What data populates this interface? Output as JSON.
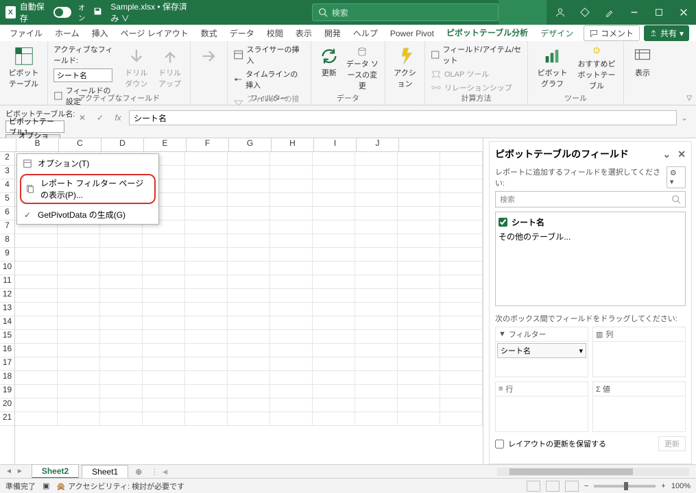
{
  "titlebar": {
    "autosave_label": "自動保存",
    "autosave_state": "オン",
    "filename": "Sample.xlsx • 保存済み ∨",
    "search_placeholder": "検索"
  },
  "tabs": {
    "items": [
      "ファイル",
      "ホーム",
      "挿入",
      "ページ レイアウト",
      "数式",
      "データ",
      "校閲",
      "表示",
      "開発",
      "ヘルプ",
      "Power Pivot",
      "ピボットテーブル分析",
      "デザイン"
    ],
    "active_index": 11,
    "comment_label": "コメント",
    "share_label": "共有"
  },
  "ribbon": {
    "pivot_table_btn": "ピボットテーブル",
    "active_field_label": "アクティブなフィールド:",
    "active_field_value": "シート名",
    "field_settings_label": "フィールドの設定",
    "drilldown_label": "ドリルダウン",
    "drillup_label": "ドリルアップ",
    "group1_footer": "アクティブなフィールド",
    "group_arrow_label": "→",
    "slicer_insert": "スライサーの挿入",
    "timeline_insert": "タイムラインの挿入",
    "filter_connect": "フィルターの接続",
    "group2_footer": "フィルター",
    "refresh_label": "更新",
    "data_source_label": "データ ソースの変更",
    "group3_footer": "データ",
    "action_label": "アクション",
    "field_item_set": "フィールド/アイテム/セット",
    "olap_tool": "OLAP ツール",
    "relationship": "リレーションシップ",
    "group4_footer": "計算方法",
    "pivot_chart": "ピボットグラフ",
    "recommend_pivot": "おすすめピボットテーブル",
    "display_label": "表示",
    "group5_footer": "ツール"
  },
  "pvbar": {
    "label": "ピボットテーブル名:",
    "value": "ピボットテーブル1",
    "option_btn": "オプション",
    "formula_value": "シート名"
  },
  "options_menu": {
    "item1": "オプション(T)",
    "item2": "レポート フィルター ページの表示(P)...",
    "item3": "GetPivotData の生成(G)"
  },
  "columns": [
    "B",
    "C",
    "D",
    "E",
    "F",
    "G",
    "H",
    "I",
    "J"
  ],
  "rows_start": 2,
  "rows_end": 21,
  "fieldpane": {
    "title": "ピボットテーブルのフィールド",
    "subtitle": "レポートに追加するフィールドを選択してください:",
    "search_placeholder": "検索",
    "field0_label": "シート名",
    "field0_checked": true,
    "other_tables": "その他のテーブル...",
    "drag_msg": "次のボックス間でフィールドをドラッグしてください:",
    "box_filter": "フィルター",
    "box_columns": "列",
    "box_rows": "行",
    "box_values": "Σ 値",
    "filter_chip": "シート名",
    "defer_label": "レイアウトの更新を保留する",
    "update_btn": "更新"
  },
  "sheetbar": {
    "tab0": "Sheet2",
    "tab1": "Sheet1",
    "active": 0
  },
  "statusbar": {
    "ready": "準備完了",
    "accessibility": "アクセシビリティ: 検討が必要です",
    "zoom": "100%"
  }
}
